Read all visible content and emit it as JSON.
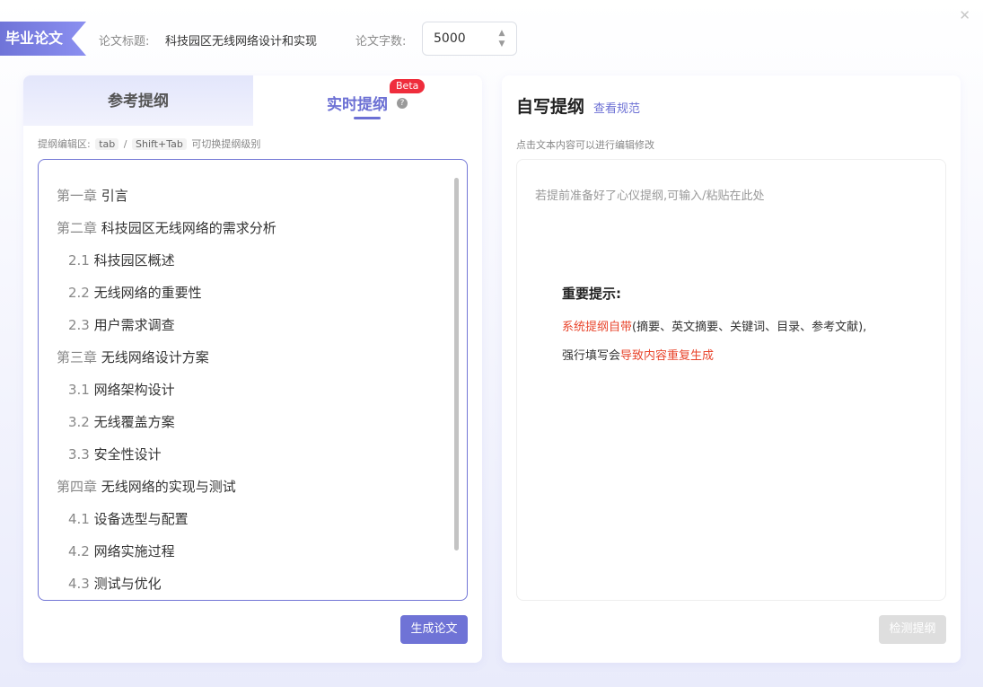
{
  "header": {
    "tag": "毕业论文",
    "title_label": "论文标题:",
    "title_value": "科技园区无线网络设计和实现",
    "words_label": "论文字数:",
    "words_value": "5000"
  },
  "icons": {
    "close": "close-icon",
    "help": "question-circle-icon",
    "stepper": "stepper-arrows-icon"
  },
  "left": {
    "tab_ref": "参考提纲",
    "tab_live": "实时提纲",
    "beta": "Beta",
    "hint_prefix": "提纲编辑区:",
    "kbd_tab": "tab",
    "slash": "/",
    "kbd_shift_tab": "Shift+Tab",
    "hint_suffix": "可切换提纲级别",
    "outline": [
      {
        "num": "第一章",
        "text": "引言",
        "level": 1
      },
      {
        "num": "第二章",
        "text": "科技园区无线网络的需求分析",
        "level": 1
      },
      {
        "num": "2.1",
        "text": "科技园区概述",
        "level": 2
      },
      {
        "num": "2.2",
        "text": "无线网络的重要性",
        "level": 2
      },
      {
        "num": "2.3",
        "text": "用户需求调查",
        "level": 2
      },
      {
        "num": "第三章",
        "text": "无线网络设计方案",
        "level": 1
      },
      {
        "num": "3.1",
        "text": "网络架构设计",
        "level": 2
      },
      {
        "num": "3.2",
        "text": "无线覆盖方案",
        "level": 2
      },
      {
        "num": "3.3",
        "text": "安全性设计",
        "level": 2
      },
      {
        "num": "第四章",
        "text": "无线网络的实现与测试",
        "level": 1
      },
      {
        "num": "4.1",
        "text": "设备选型与配置",
        "level": 2
      },
      {
        "num": "4.2",
        "text": "网络实施过程",
        "level": 2
      },
      {
        "num": "4.3",
        "text": "测试与优化",
        "level": 2
      }
    ],
    "generate_btn": "生成论文"
  },
  "right": {
    "title": "自写提纲",
    "link": "查看规范",
    "hint": "点击文本内容可以进行编辑修改",
    "placeholder": "若提前准备好了心仪提纲,可输入/粘贴在此处",
    "important_title": "重要提示:",
    "line1_red": "系统提纲自带",
    "line1_rest": "(摘要、英文摘要、关键词、目录、参考文献),",
    "line2_prefix": "强行填写会",
    "line2_red": "导致内容重复生成",
    "check_btn": "检测提纲"
  },
  "colors": {
    "accent": "#6c70d4",
    "warning": "#e8452c",
    "beta": "#ef2d3c"
  }
}
